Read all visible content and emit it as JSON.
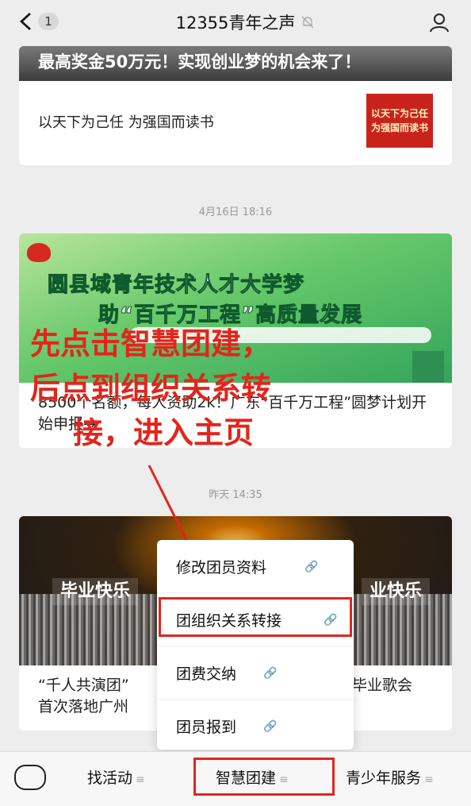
{
  "header": {
    "back_badge": "1",
    "title": "12355青年之声"
  },
  "feed": {
    "card1": {
      "banner": "最高奖金50万元！实现创业梦的机会来了！",
      "item_title": "以天下为己任 为强国而读书",
      "thumb_line1": "以天下为己任",
      "thumb_line2": "为强国而读书"
    },
    "time2": "4月16日 18:16",
    "card2": {
      "hero_line1": "圆县域青年技术人才大学梦",
      "hero_line2": "助“百千万工程”高质量发展",
      "title": "8500个名额，每人资助2k！广东“百千万工程”圆梦计划开始申报→"
    },
    "time3": "昨天 14:35",
    "card3": {
      "banner_left": "毕业快乐",
      "banner_right": "业快乐",
      "title_left_line1": "“千人共演团”",
      "title_left_line2": "首次落地广州",
      "title_right": "毕业歌会"
    }
  },
  "annotation": {
    "line1": "先点击智慧团建，",
    "line2": "后点到组织关系转",
    "line3": "接，进入主页",
    "color": "#e3251c"
  },
  "menu": {
    "items": [
      {
        "label": "修改团员资料"
      },
      {
        "label": "团组织关系转接"
      },
      {
        "label": "团费交纳"
      },
      {
        "label": "团员报到"
      }
    ]
  },
  "bottom_tabs": {
    "tab1": "找活动",
    "tab2": "智慧团建",
    "tab3": "青少年服务"
  }
}
